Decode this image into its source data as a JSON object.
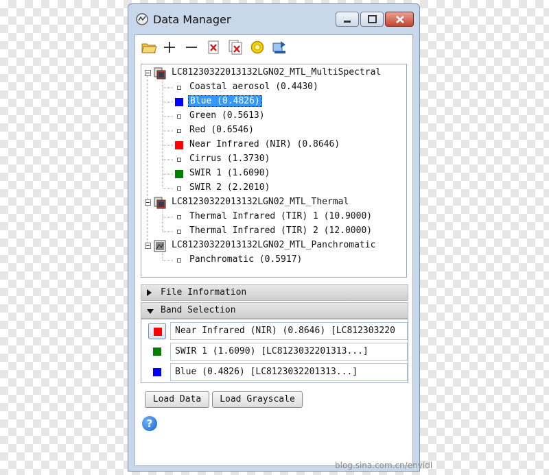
{
  "window": {
    "title": "Data Manager",
    "icon": "data-manager-icon",
    "controls": [
      "minimize-icon",
      "maximize-icon",
      "close-icon"
    ]
  },
  "toolbar": {
    "icons": [
      "open-folder-icon",
      "add-icon",
      "remove-icon",
      "close-file-icon",
      "close-all-files-icon",
      "pin-icon",
      "export-icon"
    ]
  },
  "tree": {
    "files": [
      {
        "name": "LC81230322013132LGN02_MTL_MultiSpectral",
        "icon": "multispectral-file-icon",
        "bands": [
          {
            "label": "Coastal aerosol (0.4430)",
            "color": null,
            "selected": false
          },
          {
            "label": "Blue (0.4826)",
            "color": "#0000ff",
            "selected": true
          },
          {
            "label": "Green (0.5613)",
            "color": null,
            "selected": false
          },
          {
            "label": "Red (0.6546)",
            "color": null,
            "selected": false
          },
          {
            "label": "Near Infrared (NIR) (0.8646)",
            "color": "#ff0000",
            "selected": false
          },
          {
            "label": "Cirrus (1.3730)",
            "color": null,
            "selected": false
          },
          {
            "label": "SWIR 1 (1.6090)",
            "color": "#008000",
            "selected": false
          },
          {
            "label": "SWIR 2 (2.2010)",
            "color": null,
            "selected": false
          }
        ]
      },
      {
        "name": "LC81230322013132LGN02_MTL_Thermal",
        "icon": "thermal-file-icon",
        "bands": [
          {
            "label": "Thermal Infrared (TIR) 1 (10.9000)",
            "color": null,
            "selected": false
          },
          {
            "label": "Thermal Infrared (TIR) 2 (12.0000)",
            "color": null,
            "selected": false
          }
        ]
      },
      {
        "name": "LC81230322013132LGN02_MTL_Panchromatic",
        "icon": "panchromatic-file-icon",
        "bands": [
          {
            "label": "Panchromatic (0.5917)",
            "color": null,
            "selected": false
          }
        ]
      }
    ]
  },
  "sections": {
    "file_information": {
      "label": "File Information",
      "expanded": false
    },
    "band_selection": {
      "label": "Band Selection",
      "expanded": true
    }
  },
  "band_selection": [
    {
      "color": "#ff0000",
      "text": "Near Infrared (NIR) (0.8646) [LC812303220",
      "active": true
    },
    {
      "color": "#008000",
      "text": "SWIR 1 (1.6090) [LC8123032201313...]",
      "active": false
    },
    {
      "color": "#0000ff",
      "text": "Blue (0.4826) [LC8123032201313...]",
      "active": false
    }
  ],
  "buttons": {
    "load_data": "Load Data",
    "load_grayscale": "Load Grayscale"
  },
  "help": {
    "glyph": "?",
    "icon": "help-icon"
  },
  "watermark": "blog.sina.com.cn/envidl"
}
